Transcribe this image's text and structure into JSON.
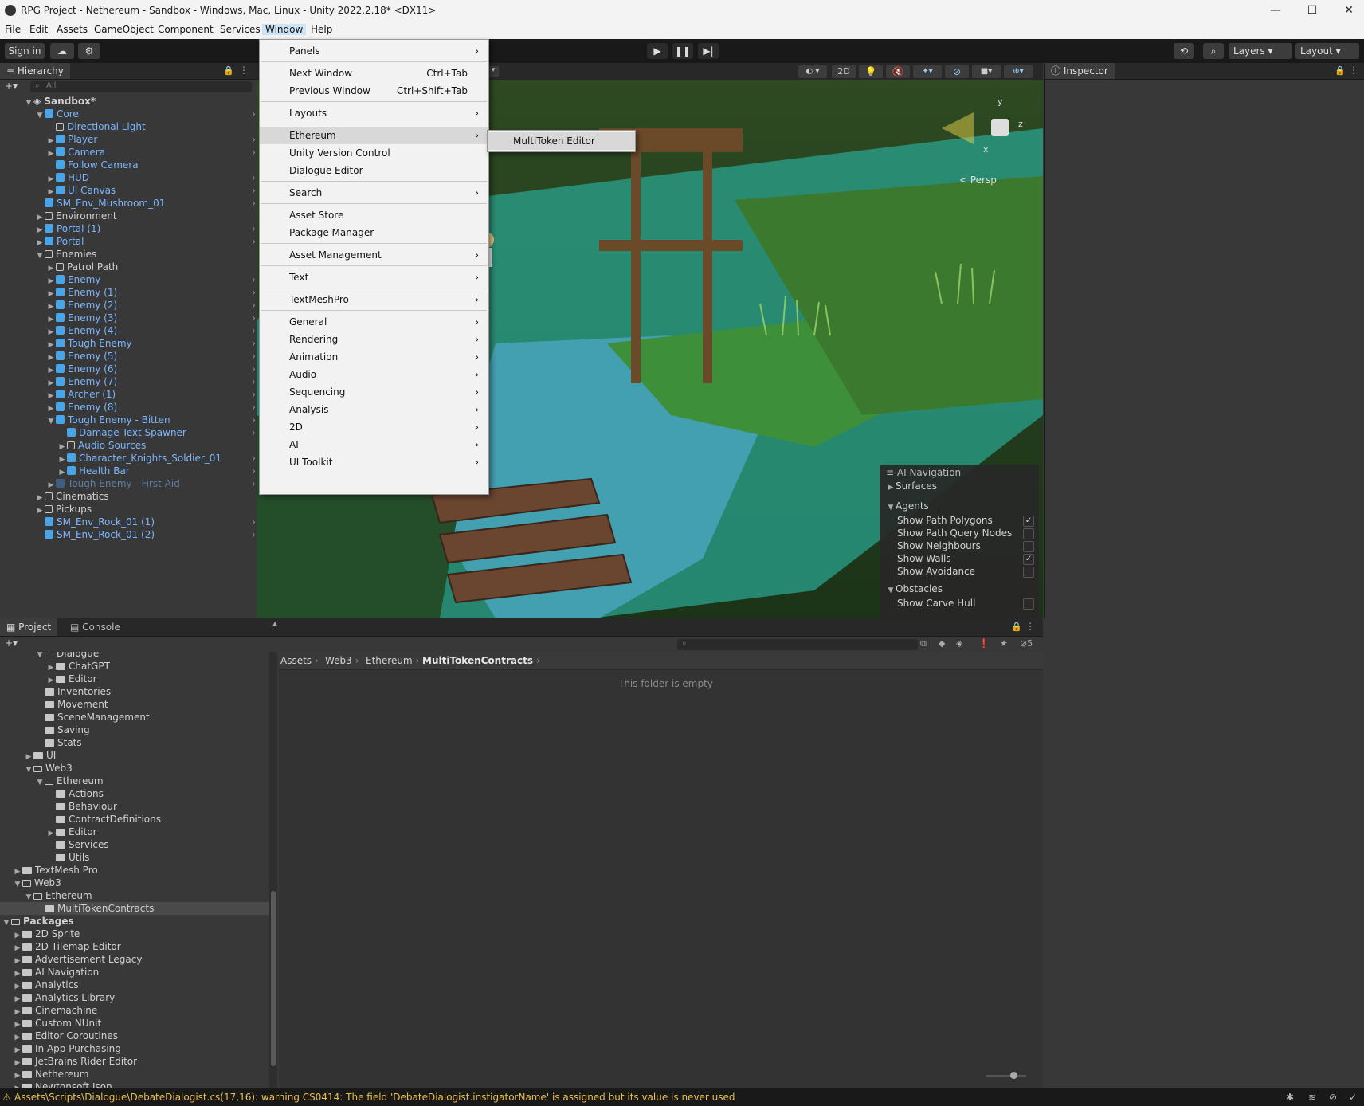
{
  "window": {
    "title": "RPG Project - Nethereum - Sandbox - Windows, Mac, Linux - Unity 2022.2.18* <DX11>",
    "minimize": "—",
    "maximize": "☐",
    "close": "✕"
  },
  "menubar": [
    "File",
    "Edit",
    "Assets",
    "GameObject",
    "Component",
    "Services",
    "Window",
    "Help"
  ],
  "toolbar": {
    "sign_in": "Sign in",
    "layers": "Layers",
    "layout": "Layout"
  },
  "hierarchy": {
    "tab": "Hierarchy",
    "search_placeholder": "All",
    "scene_name": "Sandbox*",
    "items": [
      {
        "label": "Core",
        "style": "prefab"
      },
      {
        "label": "Directional Light",
        "style": "prefab"
      },
      {
        "label": "Player",
        "style": "prefab"
      },
      {
        "label": "Camera",
        "style": "prefab"
      },
      {
        "label": "Follow Camera",
        "style": "prefab"
      },
      {
        "label": "HUD",
        "style": "prefab"
      },
      {
        "label": "UI Canvas",
        "style": "prefab"
      },
      {
        "label": "SM_Env_Mushroom_01",
        "style": "prefab"
      },
      {
        "label": "Environment",
        "style": "plain"
      },
      {
        "label": "Portal (1)",
        "style": "prefab"
      },
      {
        "label": "Portal",
        "style": "prefab"
      },
      {
        "label": "Enemies",
        "style": "plain"
      },
      {
        "label": "Patrol Path",
        "style": "plain"
      },
      {
        "label": "Enemy",
        "style": "prefab"
      },
      {
        "label": "Enemy (1)",
        "style": "prefab"
      },
      {
        "label": "Enemy (2)",
        "style": "prefab"
      },
      {
        "label": "Enemy (3)",
        "style": "prefab"
      },
      {
        "label": "Enemy (4)",
        "style": "prefab"
      },
      {
        "label": "Tough Enemy",
        "style": "prefab"
      },
      {
        "label": "Enemy (5)",
        "style": "prefab"
      },
      {
        "label": "Enemy (6)",
        "style": "prefab"
      },
      {
        "label": "Enemy (7)",
        "style": "prefab"
      },
      {
        "label": "Archer (1)",
        "style": "prefab"
      },
      {
        "label": "Enemy (8)",
        "style": "prefab"
      },
      {
        "label": "Tough Enemy - Bitten",
        "style": "prefab"
      },
      {
        "label": "Damage Text Spawner",
        "style": "prefab"
      },
      {
        "label": "Audio Sources",
        "style": "prefab"
      },
      {
        "label": "Character_Knights_Soldier_01",
        "style": "prefab"
      },
      {
        "label": "Health Bar",
        "style": "prefab"
      },
      {
        "label": "Tough Enemy - First Aid",
        "style": "dim"
      },
      {
        "label": "Cinematics",
        "style": "plain"
      },
      {
        "label": "Pickups",
        "style": "plain"
      },
      {
        "label": "SM_Env_Rock_01 (1)",
        "style": "prefab"
      },
      {
        "label": "SM_Env_Rock_01 (2)",
        "style": "prefab"
      }
    ]
  },
  "window_menu": {
    "items": [
      {
        "label": "Panels",
        "submenu": true
      },
      {
        "label": "Next Window",
        "shortcut": "Ctrl+Tab"
      },
      {
        "label": "Previous Window",
        "shortcut": "Ctrl+Shift+Tab"
      },
      {
        "label": "Layouts",
        "submenu": true
      },
      {
        "label": "Ethereum",
        "submenu": true
      },
      {
        "label": "Unity Version Control"
      },
      {
        "label": "Dialogue Editor"
      },
      {
        "label": "Search",
        "submenu": true
      },
      {
        "label": "Asset Store"
      },
      {
        "label": "Package Manager"
      },
      {
        "label": "Asset Management",
        "submenu": true
      },
      {
        "label": "Text",
        "submenu": true
      },
      {
        "label": "TextMeshPro",
        "submenu": true
      },
      {
        "label": "General",
        "submenu": true
      },
      {
        "label": "Rendering",
        "submenu": true
      },
      {
        "label": "Animation",
        "submenu": true
      },
      {
        "label": "Audio",
        "submenu": true
      },
      {
        "label": "Sequencing",
        "submenu": true
      },
      {
        "label": "Analysis",
        "submenu": true
      },
      {
        "label": "2D",
        "submenu": true
      },
      {
        "label": "AI",
        "submenu": true
      },
      {
        "label": "UI Toolkit",
        "submenu": true
      }
    ],
    "ethereum_submenu": [
      "MultiToken Editor"
    ]
  },
  "scene_view": {
    "mode_2d": "2D",
    "persp": "< Persp",
    "gizmo_y": "y",
    "gizmo_z": "z",
    "gizmo_x": "x"
  },
  "ai_navigation": {
    "title": "AI Navigation",
    "surfaces": "Surfaces",
    "agents": "Agents",
    "agent_options": [
      {
        "label": "Show Path Polygons",
        "checked": true
      },
      {
        "label": "Show Path Query Nodes",
        "checked": false
      },
      {
        "label": "Show Neighbours",
        "checked": false
      },
      {
        "label": "Show Walls",
        "checked": true
      },
      {
        "label": "Show Avoidance",
        "checked": false
      }
    ],
    "obstacles": "Obstacles",
    "obstacle_options": [
      {
        "label": "Show Carve Hull",
        "checked": false
      }
    ]
  },
  "inspector": {
    "tab": "Inspector"
  },
  "project": {
    "tab_project": "Project",
    "tab_console": "Console",
    "hidden_count": "5",
    "breadcrumb": [
      "Assets",
      "Web3",
      "Ethereum",
      "MultiTokenContracts"
    ],
    "empty_text": "This folder is empty",
    "tree": [
      {
        "label": "Dialogue"
      },
      {
        "label": "ChatGPT"
      },
      {
        "label": "Editor"
      },
      {
        "label": "Inventories"
      },
      {
        "label": "Movement"
      },
      {
        "label": "SceneManagement"
      },
      {
        "label": "Saving"
      },
      {
        "label": "Stats"
      },
      {
        "label": "UI"
      },
      {
        "label": "Web3"
      },
      {
        "label": "Ethereum"
      },
      {
        "label": "Actions"
      },
      {
        "label": "Behaviour"
      },
      {
        "label": "ContractDefinitions"
      },
      {
        "label": "Editor"
      },
      {
        "label": "Services"
      },
      {
        "label": "Utils"
      },
      {
        "label": "TextMesh Pro"
      },
      {
        "label": "Web3"
      },
      {
        "label": "Ethereum"
      },
      {
        "label": "MultiTokenContracts"
      },
      {
        "label": "Packages"
      },
      {
        "label": "2D Sprite"
      },
      {
        "label": "2D Tilemap Editor"
      },
      {
        "label": "Advertisement Legacy"
      },
      {
        "label": "AI Navigation"
      },
      {
        "label": "Analytics"
      },
      {
        "label": "Analytics Library"
      },
      {
        "label": "Cinemachine"
      },
      {
        "label": "Custom NUnit"
      },
      {
        "label": "Editor Coroutines"
      },
      {
        "label": "In App Purchasing"
      },
      {
        "label": "JetBrains Rider Editor"
      },
      {
        "label": "Nethereum"
      },
      {
        "label": "Newtonsoft Json"
      }
    ]
  },
  "status": {
    "message": "Assets\\Scripts\\Dialogue\\DebateDialogist.cs(17,16): warning CS0414: The field 'DebateDialogist.instigatorName' is assigned but its value is never used"
  },
  "colors": {
    "prefab_text": "#7cb6ff",
    "warning": "#e8c04a",
    "menu_bg": "#f2f2f2",
    "editor_bg": "#383838"
  }
}
